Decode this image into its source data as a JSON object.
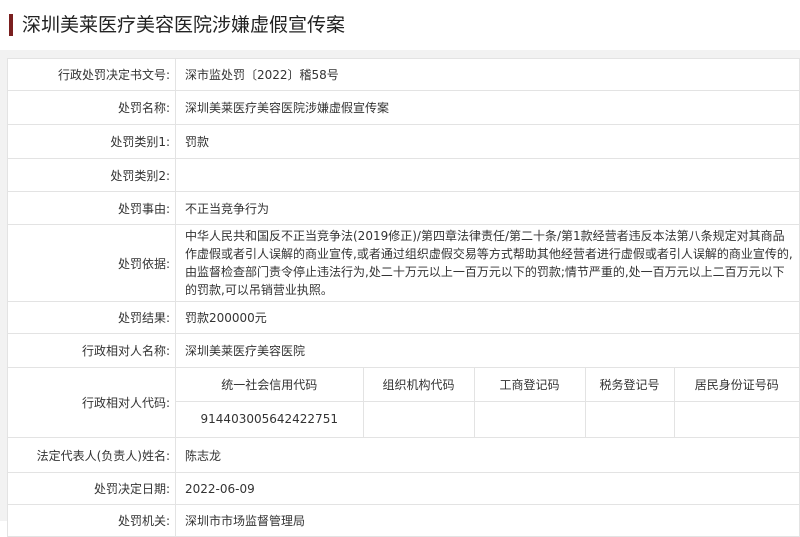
{
  "page": {
    "title": "深圳美莱医疗美容医院涉嫌虚假宣传案",
    "accent_color": "#7a1f1f"
  },
  "rows": {
    "decision_number": {
      "label": "行政处罚决定书文号:",
      "value": "深市监处罚〔2022〕稽58号"
    },
    "penalty_name": {
      "label": "处罚名称:",
      "value": "深圳美莱医疗美容医院涉嫌虚假宣传案"
    },
    "penalty_category_1": {
      "label": "处罚类别1:",
      "value": "罚款"
    },
    "penalty_category_2": {
      "label": "处罚类别2:",
      "value": ""
    },
    "penalty_reason": {
      "label": "处罚事由:",
      "value": "不正当竞争行为"
    },
    "penalty_basis": {
      "label": "处罚依据:",
      "value": "中华人民共和国反不正当竞争法(2019修正)/第四章法律责任/第二十条/第1款经营者违反本法第八条规定对其商品作虚假或者引人误解的商业宣传,或者通过组织虚假交易等方式帮助其他经营者进行虚假或者引人误解的商业宣传的,由监督检查部门责令停止违法行为,处二十万元以上一百万元以下的罚款;情节严重的,处一百万元以上二百万元以下的罚款,可以吊销营业执照。"
    },
    "penalty_result": {
      "label": "处罚结果:",
      "value": "罚款200000元"
    },
    "counterparty_name": {
      "label": "行政相对人名称:",
      "value": "深圳美莱医疗美容医院"
    },
    "counterparty_code": {
      "label": "行政相对人代码:",
      "headers": [
        "统一社会信用代码",
        "组织机构代码",
        "工商登记码",
        "税务登记号",
        "居民身份证号码"
      ],
      "values": [
        "914403005642422751",
        "",
        "",
        "",
        ""
      ]
    },
    "legal_representative": {
      "label": "法定代表人(负责人)姓名:",
      "value": "陈志龙"
    },
    "decision_date": {
      "label": "处罚决定日期:",
      "value": "2022-06-09"
    },
    "penalty_authority": {
      "label": "处罚机关:",
      "value": "深圳市市场监督管理局"
    }
  }
}
